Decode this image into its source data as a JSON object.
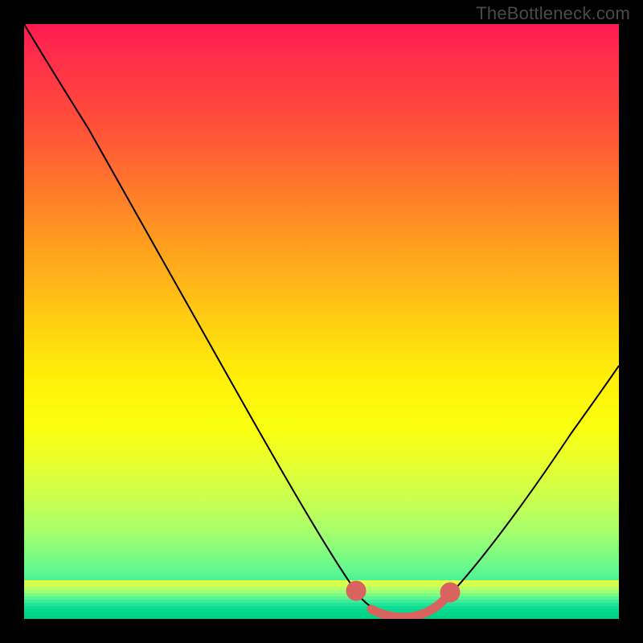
{
  "watermark": "TheBottleneck.com",
  "colors": {
    "page_bg": "#000000",
    "watermark": "#4a4a4a",
    "curve": "#000000",
    "marker": "#d9635f"
  },
  "chart_data": {
    "type": "line",
    "title": "",
    "xlabel": "",
    "ylabel": "",
    "xlim": [
      0,
      100
    ],
    "ylim": [
      0,
      100
    ],
    "series": [
      {
        "name": "bottleneck-curve",
        "x": [
          0,
          5,
          10,
          15,
          20,
          25,
          30,
          35,
          40,
          45,
          50,
          55,
          56,
          60,
          64,
          68,
          70,
          75,
          80,
          85,
          90,
          95,
          100
        ],
        "y": [
          100,
          95,
          89,
          82,
          74,
          66,
          57,
          48,
          39,
          30,
          21,
          11,
          8,
          2,
          0,
          0,
          2,
          9,
          18,
          27,
          36,
          46,
          56
        ]
      }
    ],
    "markers": {
      "name": "highlight-band",
      "x": [
        56,
        60,
        64,
        68,
        70
      ],
      "y": [
        8,
        2,
        0,
        0,
        2
      ]
    },
    "background_gradient": {
      "top": "#ff1a52",
      "bottom": "#00dd8d"
    }
  }
}
